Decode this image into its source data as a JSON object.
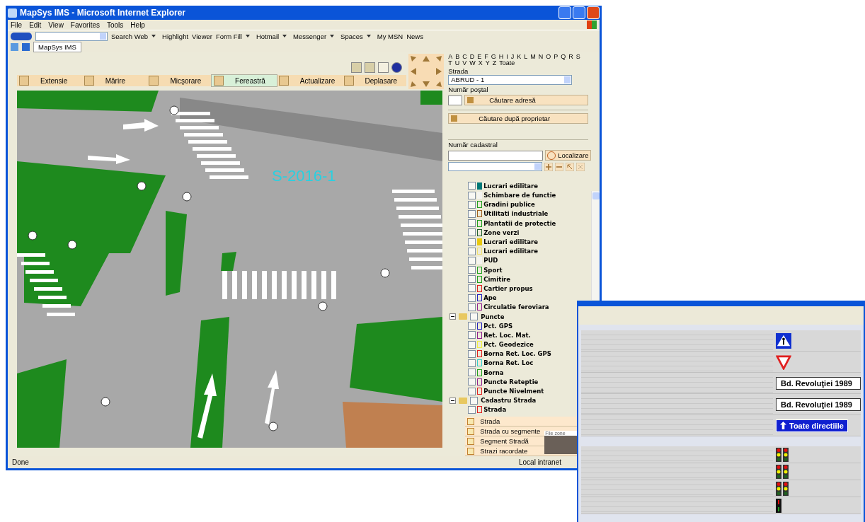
{
  "window": {
    "title": "MapSys IMS - Microsoft Internet Explorer"
  },
  "menu": [
    "File",
    "Edit",
    "View",
    "Favorites",
    "Tools",
    "Help"
  ],
  "msn_toolbar": [
    {
      "label": "Search Web",
      "dropdown": true
    },
    {
      "label": "Highlight",
      "dropdown": false
    },
    {
      "label": "Viewer",
      "dropdown": false
    },
    {
      "label": "Form Fill",
      "dropdown": true
    },
    {
      "label": "Hotmail",
      "dropdown": true
    },
    {
      "label": "Messenger",
      "dropdown": true
    },
    {
      "label": "Spaces",
      "dropdown": true
    },
    {
      "label": "My MSN",
      "dropdown": false
    },
    {
      "label": "News",
      "dropdown": false
    }
  ],
  "tab": {
    "label": "MapSys IMS"
  },
  "tools": [
    {
      "label": "Extensie",
      "selected": false
    },
    {
      "label": "Mărire",
      "selected": false
    },
    {
      "label": "Micşorare",
      "selected": false
    },
    {
      "label": "Fereastră",
      "selected": true
    },
    {
      "label": "Actualizare",
      "selected": false
    },
    {
      "label": "Deplasare",
      "selected": false
    }
  ],
  "map": {
    "label": "S-2016-1"
  },
  "letters": [
    "A",
    "B",
    "C",
    "D",
    "E",
    "F",
    "G",
    "H",
    "I",
    "J",
    "K",
    "L",
    "M",
    "N",
    "O",
    "P",
    "Q",
    "R",
    "S",
    "T",
    "U",
    "V",
    "W",
    "X",
    "Y",
    "Z",
    "Toate"
  ],
  "strada": {
    "label": "Strada",
    "value": "ABRUD - 1"
  },
  "postal": {
    "label": "Număr poştal",
    "button": "Căutare adresă"
  },
  "owner_button": "Căutare după proprietar",
  "cadastral": {
    "label": "Număr cadastral",
    "button": "Localizare"
  },
  "tree": [
    {
      "kind": "layer",
      "label": "Lucrari edilitare",
      "checked": false,
      "filled": true,
      "color": "#007878"
    },
    {
      "kind": "layer",
      "label": "Schimbare de functie",
      "checked": false,
      "filled": true,
      "color": "#f4f4f0"
    },
    {
      "kind": "layer",
      "label": "Gradini publice",
      "checked": false,
      "filled": false,
      "color": "#20a020"
    },
    {
      "kind": "layer",
      "label": "Utilitati industriale",
      "checked": false,
      "filled": false,
      "color": "#a06020"
    },
    {
      "kind": "layer",
      "label": "Plantatii de protectie",
      "checked": false,
      "filled": false,
      "color": "#20a020"
    },
    {
      "kind": "layer",
      "label": "Zone verzi",
      "checked": false,
      "filled": false,
      "color": "#206030"
    },
    {
      "kind": "layer",
      "label": "Lucrari edilitare",
      "checked": false,
      "filled": true,
      "color": "#e8c810"
    },
    {
      "kind": "layer",
      "label": "Lucrari edilitare",
      "checked": false,
      "filled": false,
      "color": "#f0e070"
    },
    {
      "kind": "layer",
      "label": "PUD",
      "checked": false,
      "filled": true,
      "color": "#f4f4f0"
    },
    {
      "kind": "layer",
      "label": "Sport",
      "checked": false,
      "filled": false,
      "color": "#20a020"
    },
    {
      "kind": "layer",
      "label": "Cimitire",
      "checked": false,
      "filled": false,
      "color": "#20a020"
    },
    {
      "kind": "layer",
      "label": "Cartier propus",
      "checked": false,
      "filled": false,
      "color": "#e02020"
    },
    {
      "kind": "layer",
      "label": "Ape",
      "checked": false,
      "filled": false,
      "color": "#2020c0"
    },
    {
      "kind": "layer",
      "label": "Circulatie feroviara",
      "checked": false,
      "filled": false,
      "color": "#902090"
    },
    {
      "kind": "group",
      "label": "Puncte",
      "checked": false,
      "expanded": true,
      "children": [
        {
          "kind": "layer",
          "label": "Pct. GPS",
          "checked": false,
          "filled": false,
          "color": "#2020c0"
        },
        {
          "kind": "layer",
          "label": "Ret. Loc. Mat.",
          "checked": false,
          "filled": false,
          "color": "#902090"
        },
        {
          "kind": "layer",
          "label": "Pct. Geodezice",
          "checked": false,
          "filled": false,
          "color": "#f0f040"
        },
        {
          "kind": "layer",
          "label": "Borna Ret. Loc. GPS",
          "checked": false,
          "filled": false,
          "color": "#e02020"
        },
        {
          "kind": "layer",
          "label": "Borna Ret. Loc",
          "checked": false,
          "filled": false,
          "color": "#30d0d0"
        },
        {
          "kind": "layer",
          "label": "Borna",
          "checked": false,
          "filled": false,
          "color": "#20a020"
        },
        {
          "kind": "layer",
          "label": "Puncte Reteptie",
          "checked": false,
          "filled": false,
          "color": "#902090"
        },
        {
          "kind": "layer",
          "label": "Puncte Nivelment",
          "checked": false,
          "filled": false,
          "color": "#e02020"
        }
      ]
    },
    {
      "kind": "group",
      "label": "Cadastru Strada",
      "checked": false,
      "expanded": true,
      "children": [
        {
          "kind": "layer",
          "label": "Strada",
          "checked": false,
          "filled": false,
          "color": "#e02020"
        }
      ]
    }
  ],
  "legend": [
    "Strada",
    "Strada cu segmente",
    "Segment Stradă",
    "Strazi racordate"
  ],
  "file_zone": "File zone",
  "status_bar": {
    "text": "Done",
    "zone": "Local intranet"
  },
  "inset_window": {
    "signs": [
      {
        "kind": "pedestrian"
      },
      {
        "kind": "yield"
      },
      {
        "kind": "arrow_right",
        "text": "Bd. Revoluţiei 1989"
      },
      {
        "kind": "arrow_left",
        "text": "Bd. Revoluţiei 1989"
      },
      {
        "kind": "all_directions",
        "text": "Toate directiile"
      }
    ],
    "lights": [
      {
        "kind": "vehicle"
      },
      {
        "kind": "vehicle"
      },
      {
        "kind": "vehicle"
      },
      {
        "kind": "pedestrian"
      }
    ]
  }
}
